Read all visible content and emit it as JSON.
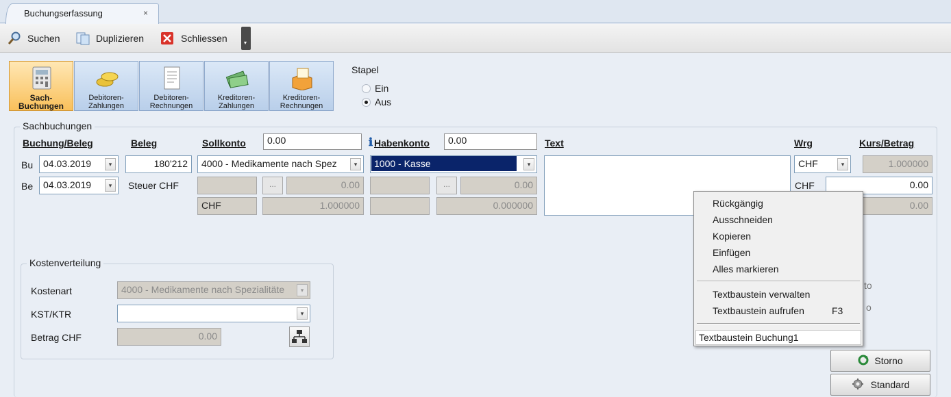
{
  "tab": {
    "title": "Buchungserfassung",
    "close": "×"
  },
  "toolbar": {
    "search": "Suchen",
    "duplicate": "Duplizieren",
    "close": "Schliessen"
  },
  "modules": [
    {
      "line1": "Sach-",
      "line2": "Buchungen"
    },
    {
      "line1": "Debitoren-",
      "line2": "Zahlungen"
    },
    {
      "line1": "Debitoren-",
      "line2": "Rechnungen"
    },
    {
      "line1": "Kreditoren-",
      "line2": "Zahlungen"
    },
    {
      "line1": "Kreditoren-",
      "line2": "Rechnungen"
    }
  ],
  "stapel": {
    "label": "Stapel",
    "option_on": "Ein",
    "option_off": "Aus",
    "selected": "Aus"
  },
  "section": {
    "title": "Sachbuchungen"
  },
  "headers": {
    "buchung_beleg": "Buchung/Beleg",
    "beleg": "Beleg",
    "sollkonto": "Sollkonto",
    "habenkonto": "Habenkonto",
    "text": "Text",
    "wrg": "Wrg",
    "kurs_betrag": "Kurs/Betrag"
  },
  "soll_total": "0.00",
  "haben_total": "0.00",
  "row_bu": {
    "label": "Bu",
    "date": "04.03.2019",
    "beleg": "180'212",
    "soll": "4000 - Medikamente nach Spez",
    "haben": "1000 - Kasse",
    "wrg": "CHF",
    "kurs": "1.000000"
  },
  "row_be": {
    "label": "Be",
    "date": "04.03.2019",
    "steuer": "Steuer CHF",
    "soll_amount": "0.00",
    "haben_amount": "0.00",
    "wrg": "CHF",
    "betrag": "0.00",
    "ellipsis": "..."
  },
  "row_3": {
    "currency": "CHF",
    "soll_rate": "1.000000",
    "haben_rate": "0.000000",
    "right_value": "0.00"
  },
  "kosten": {
    "title": "Kostenverteilung",
    "kostenart_label": "Kostenart",
    "kostenart_value": "4000 - Medikamente nach Spezialitäte",
    "kst_label": "KST/KTR",
    "kst_value": "",
    "betrag_label": "Betrag CHF",
    "betrag_value": "0.00"
  },
  "context_menu": {
    "items": [
      "Rückgängig",
      "Ausschneiden",
      "Kopieren",
      "Einfügen",
      "Alles markieren"
    ],
    "textbaustein_verwalten": "Textbaustein verwalten",
    "textbaustein_aufrufen": "Textbaustein aufrufen",
    "shortcut": "F3",
    "entry": "Textbaustein Buchung1"
  },
  "partial_right": {
    "a": "to",
    "b": "o"
  },
  "buttons": {
    "storno": "Storno",
    "standard": "Standard"
  },
  "colors": {
    "selection": "#0a246a",
    "active_module": "#f9c05b",
    "module": "#b9cfea"
  }
}
